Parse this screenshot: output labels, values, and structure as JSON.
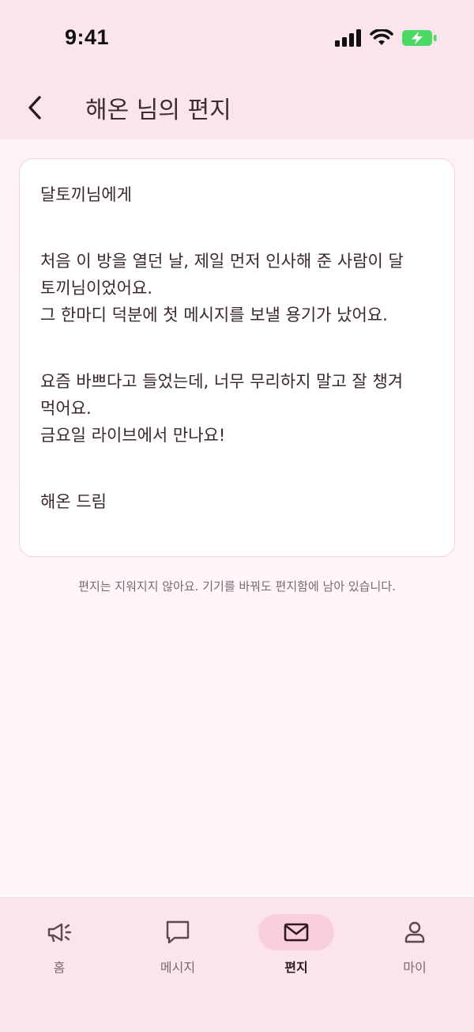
{
  "status_bar": {
    "time": "9:41"
  },
  "header": {
    "title": "해온 님의 편지"
  },
  "letter": {
    "greeting": "달토끼님에게",
    "paragraph1": [
      "처음 이 방을 열던 날, 제일 먼저 인사해 준 사람이 달",
      "토끼님이었어요.",
      "그 한마디 덕분에 첫 메시지를 보낼 용기가 났어요."
    ],
    "paragraph2": [
      "요즘 바쁘다고 들었는데, 너무 무리하지 말고 잘 챙겨",
      "먹어요.",
      "금요일 라이브에서 만나요!"
    ],
    "signature": "해온 드림"
  },
  "footnote": "편지는 지워지지 않아요. 기기를 바꿔도 편지함에 남아 있습니다.",
  "tabs": [
    {
      "label": "홈",
      "icon": "megaphone-icon",
      "active": false
    },
    {
      "label": "메시지",
      "icon": "chat-bubble-icon",
      "active": false
    },
    {
      "label": "편지",
      "icon": "envelope-icon",
      "active": true
    },
    {
      "label": "마이",
      "icon": "person-icon",
      "active": false
    }
  ],
  "colors": {
    "header_bg": "#fbe4ec",
    "card_border": "#f6cfdc",
    "active_tab_pill": "#f9cfdc",
    "battery_green": "#4cd964"
  }
}
